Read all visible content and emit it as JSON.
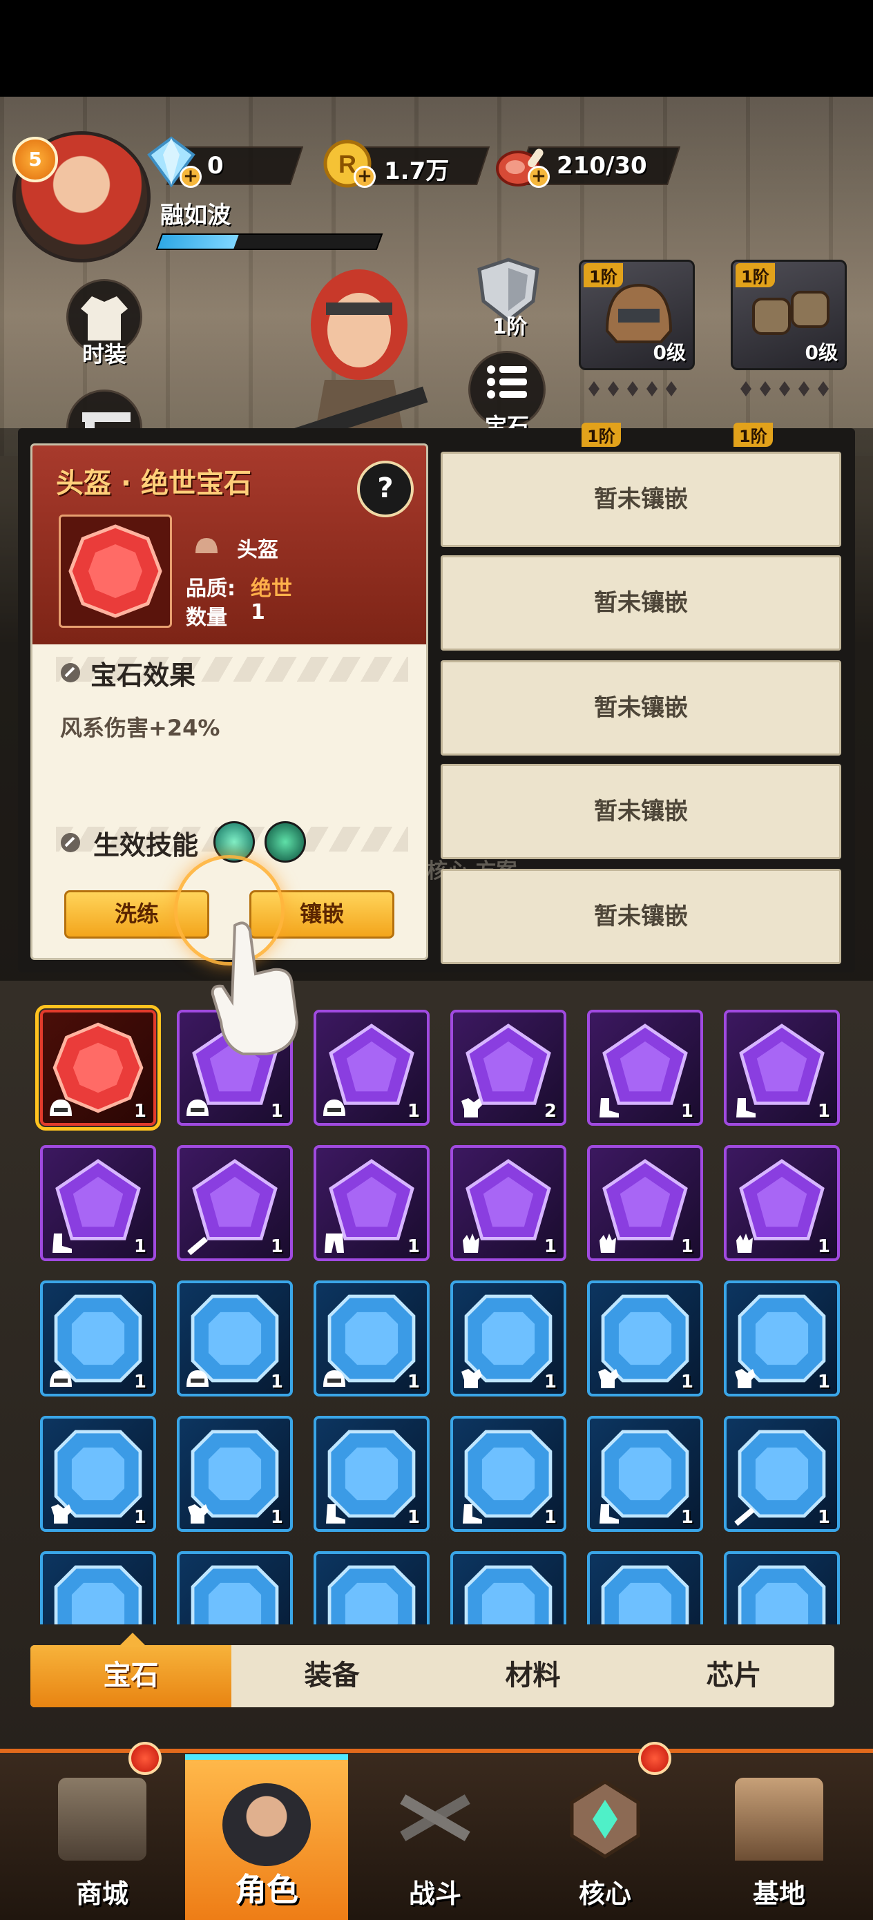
{
  "player": {
    "level": "5",
    "name": "融如波"
  },
  "resources": {
    "diamonds": "0",
    "coins": "1.7万",
    "stamina": "210/30"
  },
  "side_menu": {
    "fashion_label": "时装",
    "gem_label": "宝石"
  },
  "equipment": {
    "armor_tier": "1阶",
    "slots": [
      {
        "tier": "1阶",
        "level": "0级",
        "name": "helmet"
      },
      {
        "tier": "1阶",
        "level": "0级",
        "name": "gloves"
      }
    ],
    "hidden_tiers": [
      "1阶",
      "1阶"
    ]
  },
  "gem_detail": {
    "title": "头盔 · 绝世宝石",
    "slot_label": "头盔",
    "quality_label": "品质:",
    "quality_value": "绝世",
    "quantity_label": "数量",
    "quantity_value": "1",
    "effect_section": "宝石效果",
    "effect_text": "风系伤害+24%",
    "skill_section": "生效技能",
    "reroll_button": "洗练",
    "inlay_button": "镶嵌",
    "help_glyph": "?"
  },
  "sockets": [
    {
      "label": "暂未镶嵌"
    },
    {
      "label": "暂未镶嵌"
    },
    {
      "label": "暂未镶嵌"
    },
    {
      "label": "暂未镶嵌"
    },
    {
      "label": "暂未镶嵌"
    }
  ],
  "background_text": "核心 方案",
  "gem_grid": [
    {
      "color": "red",
      "slot": "helmet",
      "count": "1",
      "selected": true
    },
    {
      "color": "purple",
      "slot": "helmet",
      "count": "1"
    },
    {
      "color": "purple",
      "slot": "helmet",
      "count": "1"
    },
    {
      "color": "purple",
      "slot": "armor",
      "count": "2"
    },
    {
      "color": "purple",
      "slot": "boots",
      "count": "1"
    },
    {
      "color": "purple",
      "slot": "boots",
      "count": "1"
    },
    {
      "color": "purple",
      "slot": "boots",
      "count": "1"
    },
    {
      "color": "purple",
      "slot": "weapon",
      "count": "1"
    },
    {
      "color": "purple",
      "slot": "pants",
      "count": "1"
    },
    {
      "color": "purple",
      "slot": "gloves",
      "count": "1"
    },
    {
      "color": "purple",
      "slot": "gloves",
      "count": "1"
    },
    {
      "color": "purple",
      "slot": "gloves",
      "count": "1"
    },
    {
      "color": "blue",
      "slot": "helmet",
      "count": "1"
    },
    {
      "color": "blue",
      "slot": "helmet",
      "count": "1"
    },
    {
      "color": "blue",
      "slot": "helmet",
      "count": "1"
    },
    {
      "color": "blue",
      "slot": "armor",
      "count": "1"
    },
    {
      "color": "blue",
      "slot": "armor",
      "count": "1"
    },
    {
      "color": "blue",
      "slot": "armor",
      "count": "1"
    },
    {
      "color": "blue",
      "slot": "armor",
      "count": "1"
    },
    {
      "color": "blue",
      "slot": "armor",
      "count": "1"
    },
    {
      "color": "blue",
      "slot": "boots",
      "count": "1"
    },
    {
      "color": "blue",
      "slot": "boots",
      "count": "1"
    },
    {
      "color": "blue",
      "slot": "boots",
      "count": "1"
    },
    {
      "color": "blue",
      "slot": "weapon",
      "count": "1"
    },
    {
      "color": "blue",
      "slot": "armor",
      "count": ""
    },
    {
      "color": "blue",
      "slot": "armor",
      "count": ""
    },
    {
      "color": "blue",
      "slot": "armor",
      "count": ""
    },
    {
      "color": "blue",
      "slot": "armor",
      "count": ""
    },
    {
      "color": "blue",
      "slot": "armor",
      "count": ""
    },
    {
      "color": "blue",
      "slot": "armor",
      "count": ""
    }
  ],
  "category_tabs": [
    {
      "label": "宝石",
      "active": true
    },
    {
      "label": "装备"
    },
    {
      "label": "材料"
    },
    {
      "label": "芯片"
    }
  ],
  "bottom_nav": [
    {
      "label": "商城",
      "icon": "shop-building-icon",
      "badge": true
    },
    {
      "label": "角色",
      "icon": "character-icon",
      "active": true
    },
    {
      "label": "战斗",
      "icon": "crossed-guns-icon"
    },
    {
      "label": "核心",
      "icon": "core-emblem-icon",
      "badge": true
    },
    {
      "label": "基地",
      "icon": "base-tower-icon"
    }
  ],
  "colors": {
    "accent_orange": "#f3a51c",
    "card_header_red": "#a83a2c",
    "gem_red": "#e23b2c",
    "gem_purple": "#a04ae0",
    "gem_blue": "#3aa6e8"
  }
}
